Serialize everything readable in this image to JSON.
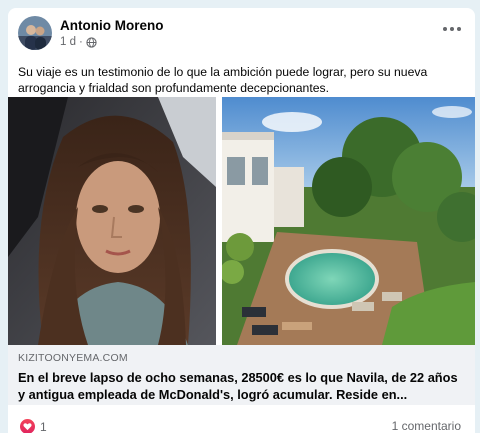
{
  "post": {
    "author": "Antonio Moreno",
    "time": "1 d",
    "separator": "·",
    "audience_icon": "globe-icon",
    "caption": "Su viaje es un testimonio de lo que la ambición puede lograr, pero su nueva arrogancia y frialdad son profundamente decepcionantes."
  },
  "link": {
    "domain": "KIZITOONYEMA.COM",
    "title": "En el breve lapso de ocho semanas, 28500€ es lo que Navila, de 22 años y antigua empleada de McDonald's, logró acumular. Reside en..."
  },
  "footer": {
    "reaction_icon": "heart-icon",
    "reaction_count": "1",
    "comments": "1 comentario"
  },
  "colors": {
    "page_background": "#e6f0f5",
    "card": "#ffffff",
    "link_background": "#f0f2f5",
    "reaction": "#e0245e",
    "secondary_text": "#65676b"
  }
}
